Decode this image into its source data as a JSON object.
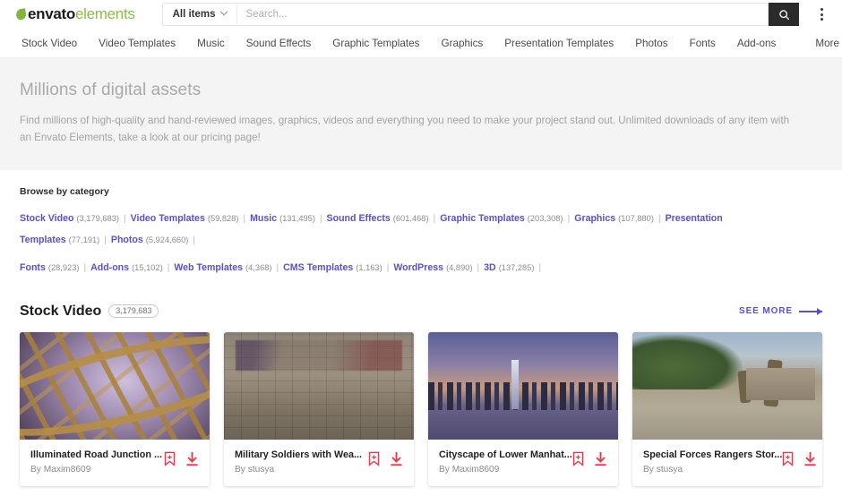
{
  "header": {
    "logo": {
      "envato": "envato",
      "elements": "elements",
      "leaf_icon": "leaf-icon"
    },
    "scope_selector": {
      "label": "All items",
      "chevron_icon": "chevron-down-icon"
    },
    "search": {
      "placeholder": "Search...",
      "value": "",
      "button_icon": "search-icon"
    },
    "overflow_icon": "kebab-menu-icon"
  },
  "nav": {
    "items": [
      {
        "label": "Stock Video"
      },
      {
        "label": "Video Templates"
      },
      {
        "label": "Music"
      },
      {
        "label": "Sound Effects"
      },
      {
        "label": "Graphic Templates"
      },
      {
        "label": "Graphics"
      },
      {
        "label": "Presentation Templates"
      },
      {
        "label": "Photos"
      },
      {
        "label": "Fonts"
      },
      {
        "label": "Add-ons"
      }
    ],
    "more": {
      "label": "More"
    }
  },
  "hero": {
    "title": "Millions of digital assets",
    "description": "Find millions of high-quality and hand-reviewed images, graphics, videos and everything you need to make your project stand out. Unlimited downloads of any item with an Envato Elements, take a look at our pricing page!"
  },
  "browse": {
    "heading": "Browse by category",
    "separator": "|",
    "rows": [
      [
        {
          "label": "Stock Video",
          "count": "(3,179,683)"
        },
        {
          "label": "Video Templates",
          "count": "(59,828)"
        },
        {
          "label": "Music",
          "count": "(131,495)"
        },
        {
          "label": "Sound Effects",
          "count": "(601,468)"
        },
        {
          "label": "Graphic Templates",
          "count": "(203,308)"
        },
        {
          "label": "Graphics",
          "count": "(107,880)"
        },
        {
          "label": "Presentation Templates",
          "count": "(77,191)"
        },
        {
          "label": "Photos",
          "count": "(5,924,660)"
        }
      ],
      [
        {
          "label": "Fonts",
          "count": "(28,923)"
        },
        {
          "label": "Add-ons",
          "count": "(15,102)"
        },
        {
          "label": "Web Templates",
          "count": "(4,368)"
        },
        {
          "label": "CMS Templates",
          "count": "(1,163)"
        },
        {
          "label": "WordPress",
          "count": "(4,890)"
        },
        {
          "label": "3D",
          "count": "(137,285)"
        }
      ]
    ]
  },
  "section": {
    "title": "Stock Video",
    "count_badge": "3,179,683",
    "see_more_label": "SEE MORE",
    "see_more_icon": "arrow-right-icon"
  },
  "cards": [
    {
      "title": "Illuminated Road Junction ...",
      "author": "By Maxim8609",
      "save_icon": "bookmark-plus-icon",
      "download_icon": "download-icon"
    },
    {
      "title": "Military Soldiers with Wea...",
      "author": "By stusya",
      "save_icon": "bookmark-plus-icon",
      "download_icon": "download-icon"
    },
    {
      "title": "Cityscape of Lower Manhat...",
      "author": "By Maxim8609",
      "save_icon": "bookmark-plus-icon",
      "download_icon": "download-icon"
    },
    {
      "title": "Special Forces Rangers Stor...",
      "author": "By stusya",
      "save_icon": "bookmark-plus-icon",
      "download_icon": "download-icon"
    }
  ],
  "colors": {
    "brand_green": "#8bbd4a",
    "link_purple": "#5a4fcf",
    "action_red": "#e8384f",
    "search_button": "#2b2b2b"
  }
}
